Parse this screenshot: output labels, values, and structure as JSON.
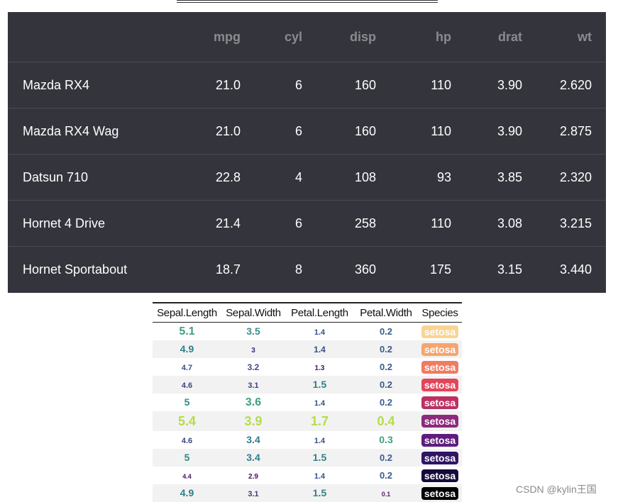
{
  "dark_table": {
    "columns": [
      "",
      "mpg",
      "cyl",
      "disp",
      "hp",
      "drat",
      "wt"
    ],
    "rows": [
      [
        "Mazda RX4",
        "21.0",
        "6",
        "160",
        "110",
        "3.90",
        "2.620"
      ],
      [
        "Mazda RX4 Wag",
        "21.0",
        "6",
        "160",
        "110",
        "3.90",
        "2.875"
      ],
      [
        "Datsun 710",
        "22.8",
        "4",
        "108",
        "93",
        "3.85",
        "2.320"
      ],
      [
        "Hornet 4 Drive",
        "21.4",
        "6",
        "258",
        "110",
        "3.08",
        "3.215"
      ],
      [
        "Hornet Sportabout",
        "18.7",
        "8",
        "360",
        "175",
        "3.15",
        "3.440"
      ]
    ]
  },
  "iris_table": {
    "columns": [
      "Sepal.Length",
      "Sepal.Width",
      "Petal.Length",
      "Petal.Width",
      "Species"
    ],
    "rows": [
      [
        {
          "text": "5.1",
          "color": "#3d9e83",
          "size": 16
        },
        {
          "text": "3.5",
          "color": "#3a8f8a",
          "size": 14
        },
        {
          "text": "1.4",
          "color": "#3b4d8a",
          "size": 11
        },
        {
          "text": "0.2",
          "color": "#3b5a8c",
          "size": 13
        },
        {
          "text": "setosa",
          "bg": "#f9d493"
        }
      ],
      [
        {
          "text": "4.9",
          "color": "#2f7f8b",
          "size": 14
        },
        {
          "text": "3",
          "color": "#46277a",
          "size": 10
        },
        {
          "text": "1.4",
          "color": "#3b4d8a",
          "size": 12
        },
        {
          "text": "0.2",
          "color": "#3b5a8c",
          "size": 13
        },
        {
          "text": "setosa",
          "bg": "#f6a56f"
        }
      ],
      [
        {
          "text": "4.7",
          "color": "#3c4f8b",
          "size": 11
        },
        {
          "text": "3.2",
          "color": "#3c4e89",
          "size": 12
        },
        {
          "text": "1.3",
          "color": "#46125e",
          "size": 10
        },
        {
          "text": "0.2",
          "color": "#3b5a8c",
          "size": 13
        },
        {
          "text": "setosa",
          "bg": "#f07b60"
        }
      ],
      [
        {
          "text": "4.6",
          "color": "#3b457f",
          "size": 11
        },
        {
          "text": "3.1",
          "color": "#3b3f80",
          "size": 11
        },
        {
          "text": "1.5",
          "color": "#2f8285",
          "size": 14
        },
        {
          "text": "0.2",
          "color": "#3b5a8c",
          "size": 13
        },
        {
          "text": "setosa",
          "bg": "#e2465b"
        }
      ],
      [
        {
          "text": "5",
          "color": "#2f8a86",
          "size": 14
        },
        {
          "text": "3.6",
          "color": "#3ea27a",
          "size": 16
        },
        {
          "text": "1.4",
          "color": "#3b4d8a",
          "size": 11
        },
        {
          "text": "0.2",
          "color": "#3b5a8c",
          "size": 13
        },
        {
          "text": "setosa",
          "bg": "#bc3163"
        }
      ],
      [
        {
          "text": "5.4",
          "color": "#b5dc4a",
          "size": 18
        },
        {
          "text": "3.9",
          "color": "#b5dc4a",
          "size": 18
        },
        {
          "text": "1.7",
          "color": "#b5dc4a",
          "size": 18
        },
        {
          "text": "0.4",
          "color": "#b5dc4a",
          "size": 18
        },
        {
          "text": "setosa",
          "bg": "#8c2a7c"
        }
      ],
      [
        {
          "text": "4.6",
          "color": "#3b457f",
          "size": 11
        },
        {
          "text": "3.4",
          "color": "#2f7f8b",
          "size": 14
        },
        {
          "text": "1.4",
          "color": "#3b4d8a",
          "size": 11
        },
        {
          "text": "0.3",
          "color": "#3d9e83",
          "size": 14
        },
        {
          "text": "setosa",
          "bg": "#5e1d7e"
        }
      ],
      [
        {
          "text": "5",
          "color": "#2f8a86",
          "size": 14
        },
        {
          "text": "3.4",
          "color": "#2f7f8b",
          "size": 14
        },
        {
          "text": "1.5",
          "color": "#2f8285",
          "size": 14
        },
        {
          "text": "0.2",
          "color": "#3b5a8c",
          "size": 13
        },
        {
          "text": "setosa",
          "bg": "#2e1464"
        }
      ],
      [
        {
          "text": "4.4",
          "color": "#46125e",
          "size": 9
        },
        {
          "text": "2.9",
          "color": "#46125e",
          "size": 10
        },
        {
          "text": "1.4",
          "color": "#3b4d8a",
          "size": 11
        },
        {
          "text": "0.2",
          "color": "#3b5a8c",
          "size": 13
        },
        {
          "text": "setosa",
          "bg": "#170b3b"
        }
      ],
      [
        {
          "text": "4.9",
          "color": "#2f7f8b",
          "size": 14
        },
        {
          "text": "3.1",
          "color": "#3b3f80",
          "size": 11
        },
        {
          "text": "1.5",
          "color": "#2f8285",
          "size": 14
        },
        {
          "text": "0.1",
          "color": "#5a1a6e",
          "size": 9
        },
        {
          "text": "setosa",
          "bg": "#000004"
        }
      ]
    ]
  },
  "watermark": "CSDN @kylin王国"
}
